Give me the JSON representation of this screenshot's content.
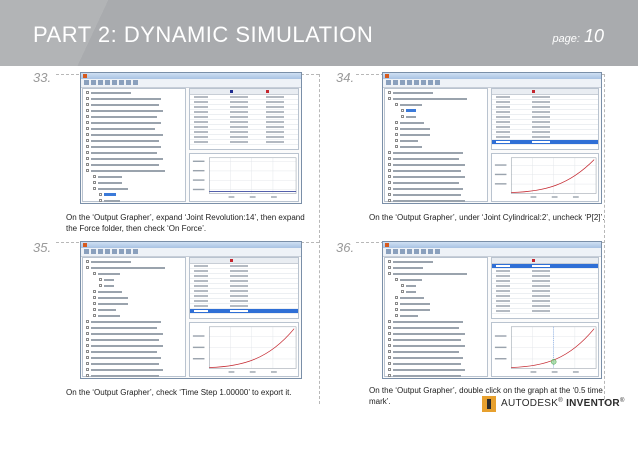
{
  "header": {
    "title": "PART 2: DYNAMIC SIMULATION",
    "page_label": "page:",
    "page_number": "10"
  },
  "steps": [
    {
      "number": "33.",
      "caption": "On the ‘Output Grapher’, expand ‘Joint Revolution:14’, then expand the Force folder, then check ‘On Force’."
    },
    {
      "number": "34.",
      "caption": "On the ‘Output Grapher’, under ‘Joint Cylindrical:2’, uncheck ‘P[2]’."
    },
    {
      "number": "35.",
      "caption": "On the ‘Output Grapher’, check ‘Time Step 1.00000’ to export it."
    },
    {
      "number": "36.",
      "caption": "On the ‘Output Grapher’, double click on the graph at the ‘0.5 time mark’."
    }
  ],
  "footer": {
    "brand": "AUTODESK",
    "product": "INVENTOR",
    "brand_color": "#e7a02e"
  }
}
